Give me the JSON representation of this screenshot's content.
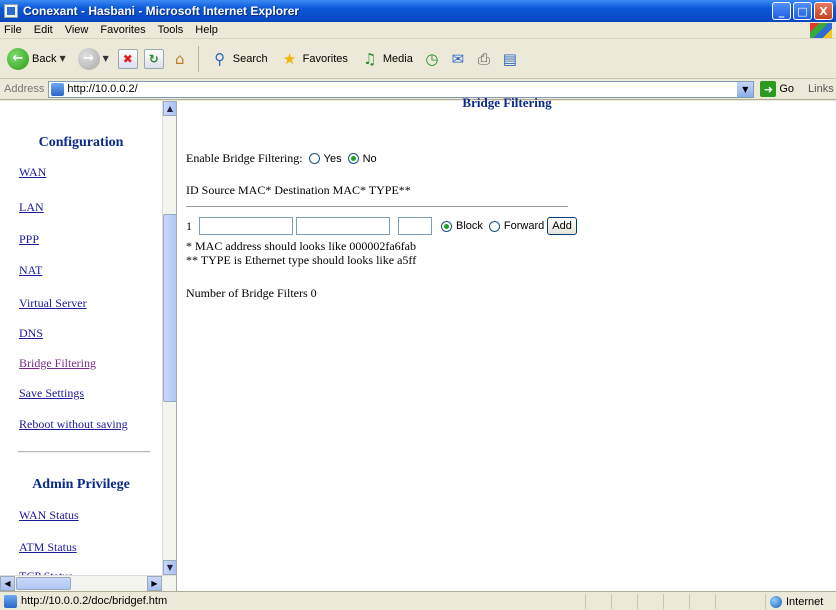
{
  "window": {
    "title": "Conexant - Hasbani - Microsoft Internet Explorer",
    "buttons": [
      "_",
      "□",
      "X"
    ]
  },
  "menu": [
    "File",
    "Edit",
    "View",
    "Favorites",
    "Tools",
    "Help"
  ],
  "toolbar": {
    "back": "Back",
    "search": "Search",
    "favorites": "Favorites",
    "media": "Media"
  },
  "address": {
    "label": "Address",
    "url": "http://10.0.0.2/",
    "go": "Go",
    "links": "Links"
  },
  "sidebar": {
    "config_title": "Configuration",
    "config_items": [
      "WAN",
      "LAN",
      "PPP",
      "NAT",
      "Virtual Server",
      "DNS",
      "Bridge Filtering",
      "Save Settings",
      "Reboot without saving"
    ],
    "admin_title": "Admin Privilege",
    "admin_items": [
      "WAN Status",
      "ATM Status",
      "TCP Status"
    ]
  },
  "main": {
    "title": "Bridge Filtering",
    "enable_label": "Enable Bridge Filtering:",
    "yes": "Yes",
    "no": "No",
    "enable_selected": "No",
    "header_row": "ID Source MAC* Destination MAC* TYPE**",
    "row_id": "1",
    "source_mac": "",
    "dest_mac": "",
    "type": "",
    "block": "Block",
    "forward": "Forward",
    "action_selected": "Block",
    "add": "Add",
    "note1": "* MAC address should looks like 000002fa6fab",
    "note2": "** TYPE is Ethernet type should looks like a5ff",
    "count_label": "Number of Bridge Filters 0"
  },
  "status": {
    "url": "http://10.0.0.2/doc/bridgef.htm",
    "zone": "Internet"
  }
}
